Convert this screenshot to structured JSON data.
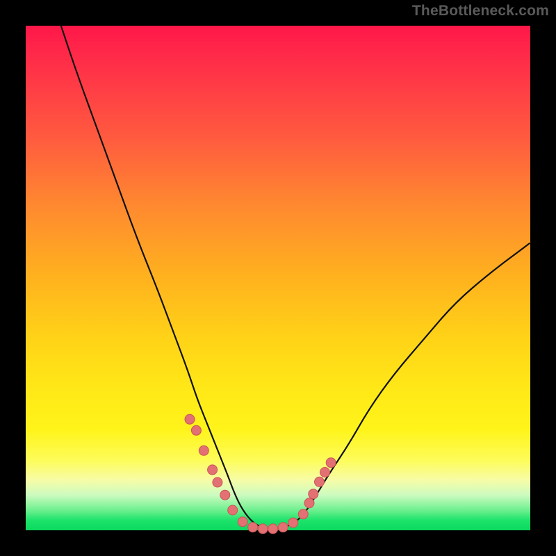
{
  "watermark": "TheBottleneck.com",
  "chart_data": {
    "type": "line",
    "title": "",
    "xlabel": "",
    "ylabel": "",
    "xlim": [
      0,
      100
    ],
    "ylim": [
      0,
      100
    ],
    "series": [
      {
        "name": "curve",
        "x": [
          7,
          10,
          14,
          18,
          22,
          26,
          29,
          32,
          34,
          36,
          38,
          40,
          41.5,
          43,
          45,
          47,
          49,
          51,
          53,
          55,
          57,
          60,
          64,
          68,
          73,
          79,
          85,
          92,
          100
        ],
        "values": [
          100,
          91,
          80,
          69,
          58,
          48,
          40,
          32,
          26,
          21,
          16,
          11,
          7,
          4,
          1.5,
          0.5,
          0.2,
          0.5,
          1.3,
          3,
          6,
          11,
          17,
          24,
          31,
          38,
          45,
          51,
          57
        ]
      }
    ],
    "markers": [
      {
        "x": 32.5,
        "y": 22.0
      },
      {
        "x": 33.8,
        "y": 19.8
      },
      {
        "x": 35.3,
        "y": 15.8
      },
      {
        "x": 37.0,
        "y": 12.0
      },
      {
        "x": 38.0,
        "y": 9.5
      },
      {
        "x": 39.5,
        "y": 7.0
      },
      {
        "x": 41.0,
        "y": 4.0
      },
      {
        "x": 43.0,
        "y": 1.7
      },
      {
        "x": 45.0,
        "y": 0.6
      },
      {
        "x": 47.0,
        "y": 0.3
      },
      {
        "x": 49.0,
        "y": 0.3
      },
      {
        "x": 51.0,
        "y": 0.6
      },
      {
        "x": 53.0,
        "y": 1.5
      },
      {
        "x": 55.0,
        "y": 3.2
      },
      {
        "x": 56.2,
        "y": 5.4
      },
      {
        "x": 57.0,
        "y": 7.2
      },
      {
        "x": 58.2,
        "y": 9.6
      },
      {
        "x": 59.3,
        "y": 11.5
      },
      {
        "x": 60.5,
        "y": 13.4
      }
    ],
    "colors": {
      "curve": "#111111",
      "marker_fill": "#e37072",
      "marker_stroke": "#c95557"
    }
  }
}
